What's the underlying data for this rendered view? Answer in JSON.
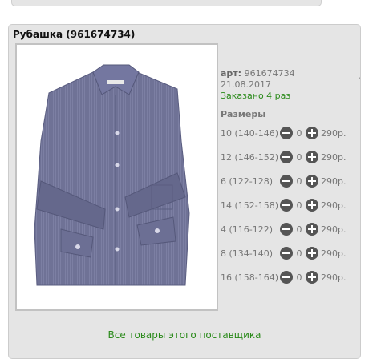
{
  "product": {
    "title": "Рубашка (961674734)",
    "article_label": "арт:",
    "article_value": "961674734",
    "date": "21.08.2017",
    "ordered": "Заказано 4 раз",
    "tick_mark": "'"
  },
  "sizes": {
    "heading": "Размеры",
    "items": [
      {
        "label": "10 (140-146)",
        "qty": "0",
        "price": "290р."
      },
      {
        "label": "12 (146-152)",
        "qty": "0",
        "price": "290р."
      },
      {
        "label": "6 (122-128)",
        "qty": "0",
        "price": "290р."
      },
      {
        "label": "14 (152-158)",
        "qty": "0",
        "price": "290р."
      },
      {
        "label": "4 (116-122)",
        "qty": "0",
        "price": "290р."
      },
      {
        "label": "8 (134-140)",
        "qty": "0",
        "price": "290р."
      },
      {
        "label": "16 (158-164)",
        "qty": "0",
        "price": "290р."
      }
    ]
  },
  "footer": {
    "supplier_link": "Все товары этого поставщика"
  },
  "colors": {
    "card_bg": "#e5e5e5",
    "link_green": "#2a8a1a",
    "button_dark": "#555555",
    "shirt": "#6f7296"
  },
  "icons": {
    "minus": "minus-icon",
    "plus": "plus-icon"
  }
}
